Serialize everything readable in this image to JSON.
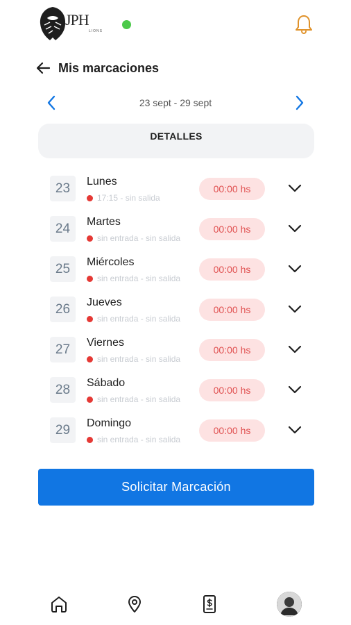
{
  "app": {
    "logo_text": "JPH",
    "logo_subtext": "LIONS",
    "online_color": "#4cc94a"
  },
  "header": {
    "title": "Mis marcaciones"
  },
  "week": {
    "range": "23 sept - 29 sept"
  },
  "tab": {
    "label": "DETALLES"
  },
  "days": [
    {
      "num": "23",
      "name": "Lunes",
      "status": "17:15 - sin salida",
      "hours": "00:00 hs"
    },
    {
      "num": "24",
      "name": "Martes",
      "status": "sin entrada - sin salida",
      "hours": "00:00 hs"
    },
    {
      "num": "25",
      "name": "Miércoles",
      "status": "sin entrada - sin salida",
      "hours": "00:00 hs"
    },
    {
      "num": "26",
      "name": "Jueves",
      "status": "sin entrada - sin salida",
      "hours": "00:00 hs"
    },
    {
      "num": "27",
      "name": "Viernes",
      "status": "sin entrada - sin salida",
      "hours": "00:00 hs"
    },
    {
      "num": "28",
      "name": "Sábado",
      "status": "sin entrada - sin salida",
      "hours": "00:00 hs"
    },
    {
      "num": "29",
      "name": "Domingo",
      "status": "sin entrada - sin salida",
      "hours": "00:00 hs"
    }
  ],
  "action": {
    "label": "Solicitar Marcación"
  },
  "colors": {
    "accent": "#1176e3",
    "bell": "#e0922a",
    "status_dot": "#e53935",
    "pill_bg": "#fde2e2",
    "pill_text": "#e05050"
  },
  "icons": {
    "back": "arrow-left-icon",
    "prev": "chevron-left-icon",
    "next": "chevron-right-icon",
    "expand": "chevron-down-icon",
    "bell": "bell-icon",
    "home": "home-icon",
    "location": "map-pin-icon",
    "document": "document-dollar-icon",
    "profile": "avatar"
  }
}
